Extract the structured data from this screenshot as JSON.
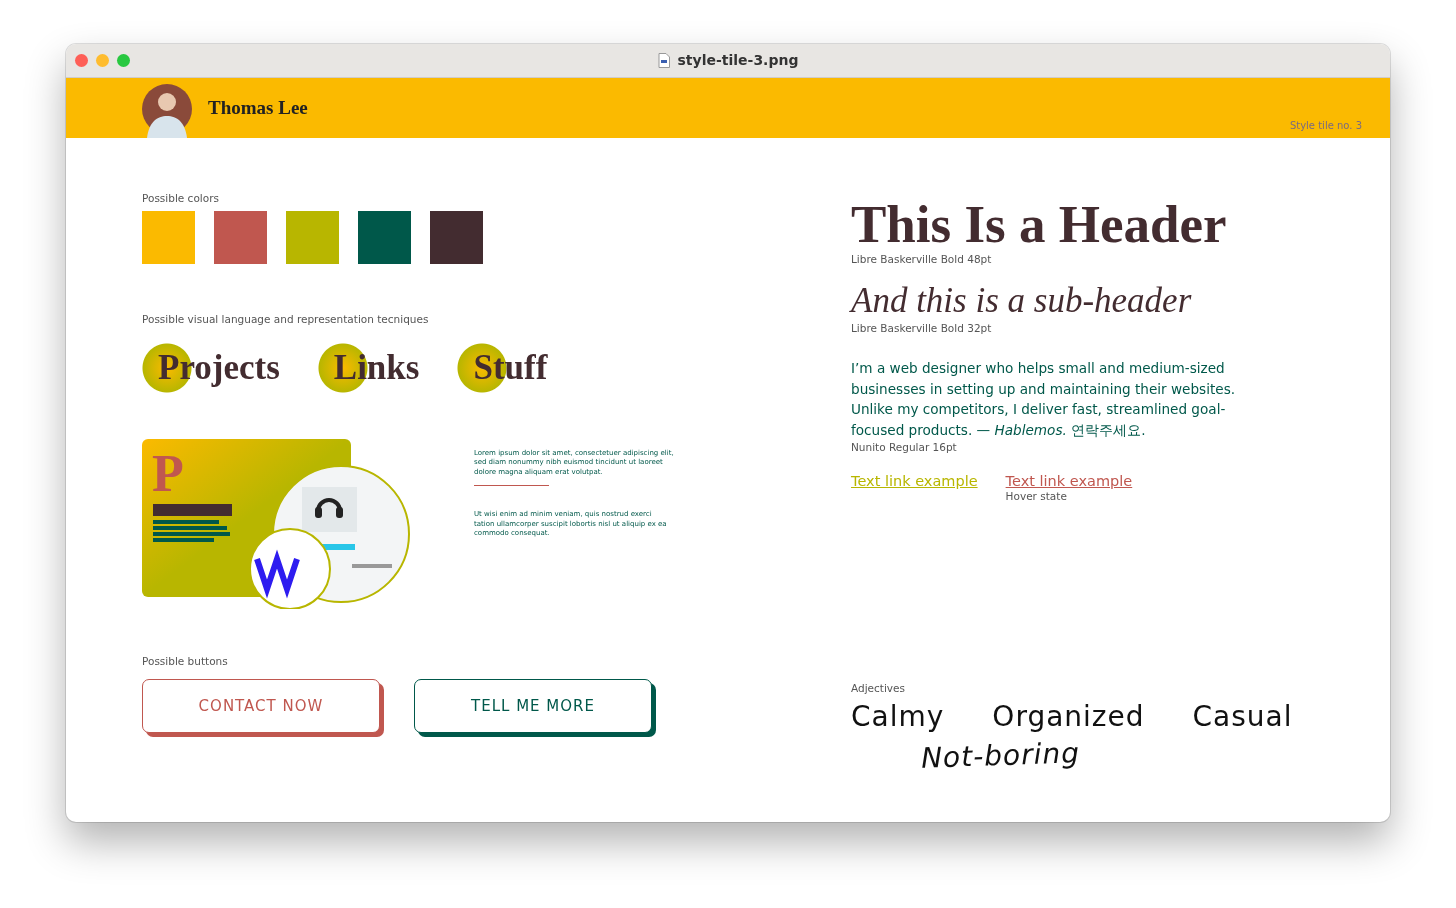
{
  "window": {
    "title": "style-tile-3.png"
  },
  "header": {
    "name": "Thomas Lee",
    "tile_label": "Style tile no. 3"
  },
  "colors": {
    "label": "Possible colors",
    "swatches": [
      {
        "color": "#fbba00"
      },
      {
        "color": "#c0574f"
      },
      {
        "color": "#b8b600"
      },
      {
        "color": "#00584a"
      },
      {
        "color": "#432c30"
      }
    ]
  },
  "visual_language": {
    "label": "Possible visual language and representation tecniques",
    "tags": [
      "Projects",
      "Links",
      "Stuff"
    ],
    "illustration_letter": "P",
    "paragraphs": [
      "Lorem ipsum dolor sit amet, consectetuer adipiscing elit, sed diam nonummy nibh euismod tincidunt ut laoreet dolore magna aliquam erat volutpat.",
      "Ut wisi enim ad minim veniam, quis nostrud exerci tation ullamcorper suscipit lobortis nisl ut aliquip ex ea commodo consequat."
    ]
  },
  "buttons": {
    "label": "Possible buttons",
    "items": [
      {
        "label": "CONTACT NOW",
        "color": "#c0574f"
      },
      {
        "label": "TELL ME MORE",
        "color": "#00584a"
      }
    ]
  },
  "typography": {
    "header": "This Is a Header",
    "header_caption": "Libre Baskerville Bold 48pt",
    "subheader": "And this is a sub-header",
    "subheader_caption": "Libre Baskerville Bold 32pt",
    "body": "I’m a web designer who helps small and medium-sized businesses in setting up and maintaining their websites. Unlike my competitors, I deliver fast, streamlined goal-focused products. — *Hablemos.* 연락주세요.",
    "body_caption": "Nunito Regular 16pt",
    "links": [
      {
        "label": "Text link example",
        "color": "#b8b600"
      },
      {
        "label": "Text link example",
        "color": "#c0574f",
        "note": "Hover state"
      }
    ]
  },
  "adjectives": {
    "label": "Adjectives",
    "items": [
      {
        "text": "Calmy",
        "italic": false
      },
      {
        "text": "Organized",
        "italic": false
      },
      {
        "text": "Casual",
        "italic": false
      },
      {
        "text": "Not-boring",
        "italic": true
      }
    ]
  }
}
